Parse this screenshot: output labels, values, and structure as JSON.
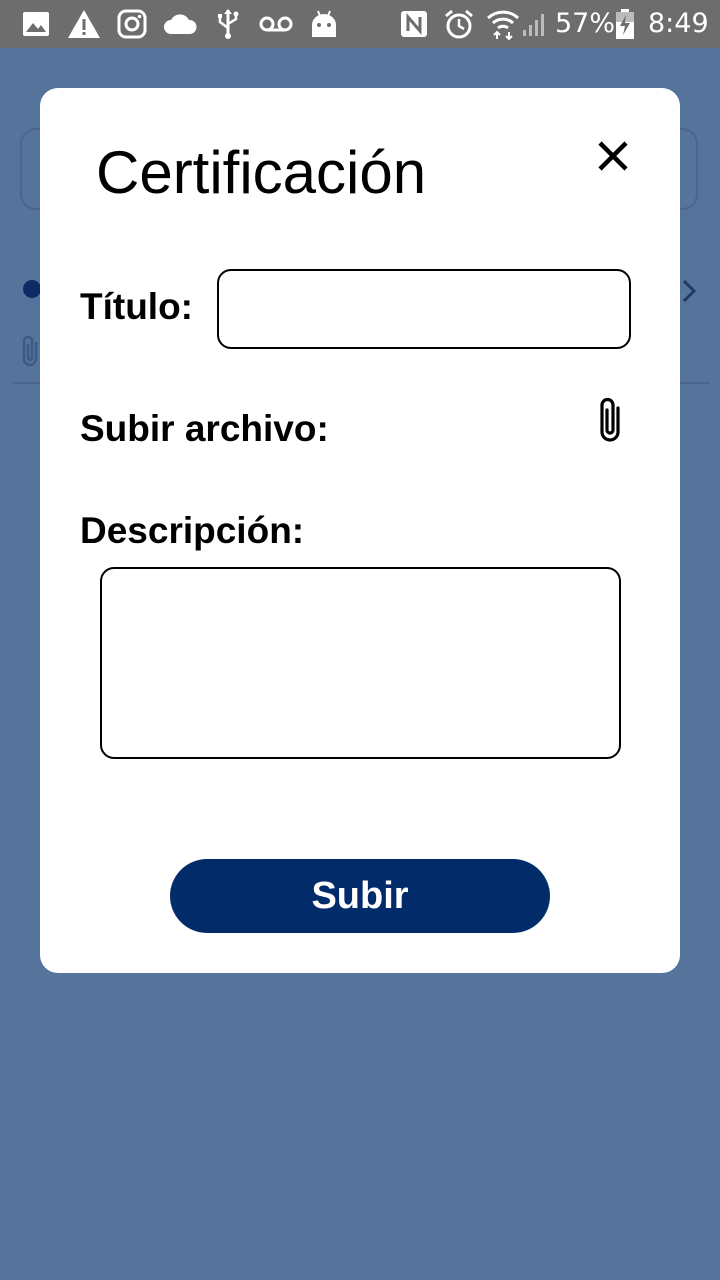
{
  "status_bar": {
    "icons": [
      "image-icon",
      "warning-icon",
      "instagram-icon",
      "cloud-icon",
      "usb-icon",
      "voicemail-icon",
      "android-icon",
      "nfc-icon",
      "alarm-icon",
      "wifi-icon",
      "signal-icon",
      "battery-charging-icon"
    ],
    "battery_percent": "57%",
    "time": "8:49"
  },
  "modal": {
    "title": "Certificación",
    "close_icon": "close-icon",
    "title_label": "Título:",
    "title_value": "",
    "upload_label": "Subir archivo:",
    "attach_icon": "paperclip-icon",
    "description_label": "Descripción:",
    "description_value": "",
    "submit_label": "Subir"
  },
  "colors": {
    "backdrop": "#55739b",
    "status_bar": "#6d6d6d",
    "modal_bg": "#ffffff",
    "primary_button": "#022b6a"
  }
}
